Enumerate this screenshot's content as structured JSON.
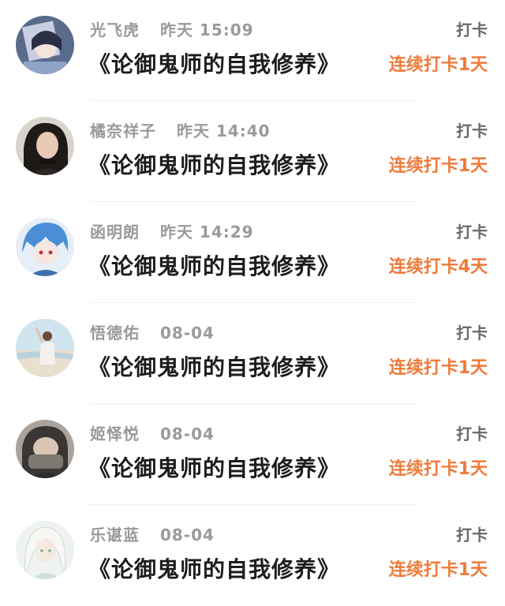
{
  "entries": [
    {
      "name": "光飞虎",
      "time": "昨天 15:09",
      "title": "《论御鬼师的自我修养》",
      "action": "打卡",
      "streak": "连续打卡1天",
      "avatar": "avatar-anime-girl-dark-hair"
    },
    {
      "name": "橘奈祥子",
      "time": "昨天 14:40",
      "title": "《论御鬼师的自我修养》",
      "action": "打卡",
      "streak": "连续打卡1天",
      "avatar": "avatar-woman-dark-hair"
    },
    {
      "name": "函明朗",
      "time": "昨天 14:29",
      "title": "《论御鬼师的自我修养》",
      "action": "打卡",
      "streak": "连续打卡4天",
      "avatar": "avatar-anime-blue-hair"
    },
    {
      "name": "悟德佑",
      "time": "08-04",
      "title": "《论御鬼师的自我修养》",
      "action": "打卡",
      "streak": "连续打卡1天",
      "avatar": "avatar-beach-figure"
    },
    {
      "name": "姬怿悦",
      "time": "08-04",
      "title": "《论御鬼师的自我修养》",
      "action": "打卡",
      "streak": "连续打卡1天",
      "avatar": "avatar-person-face-covered"
    },
    {
      "name": "乐谌蓝",
      "time": "08-04",
      "title": "《论御鬼师的自我修养》",
      "action": "打卡",
      "streak": "连续打卡1天",
      "avatar": "avatar-anime-white-hair"
    }
  ],
  "colors": {
    "streak": "#f07a3a",
    "title": "#1c1c1c",
    "meta": "#9a9a9a"
  }
}
